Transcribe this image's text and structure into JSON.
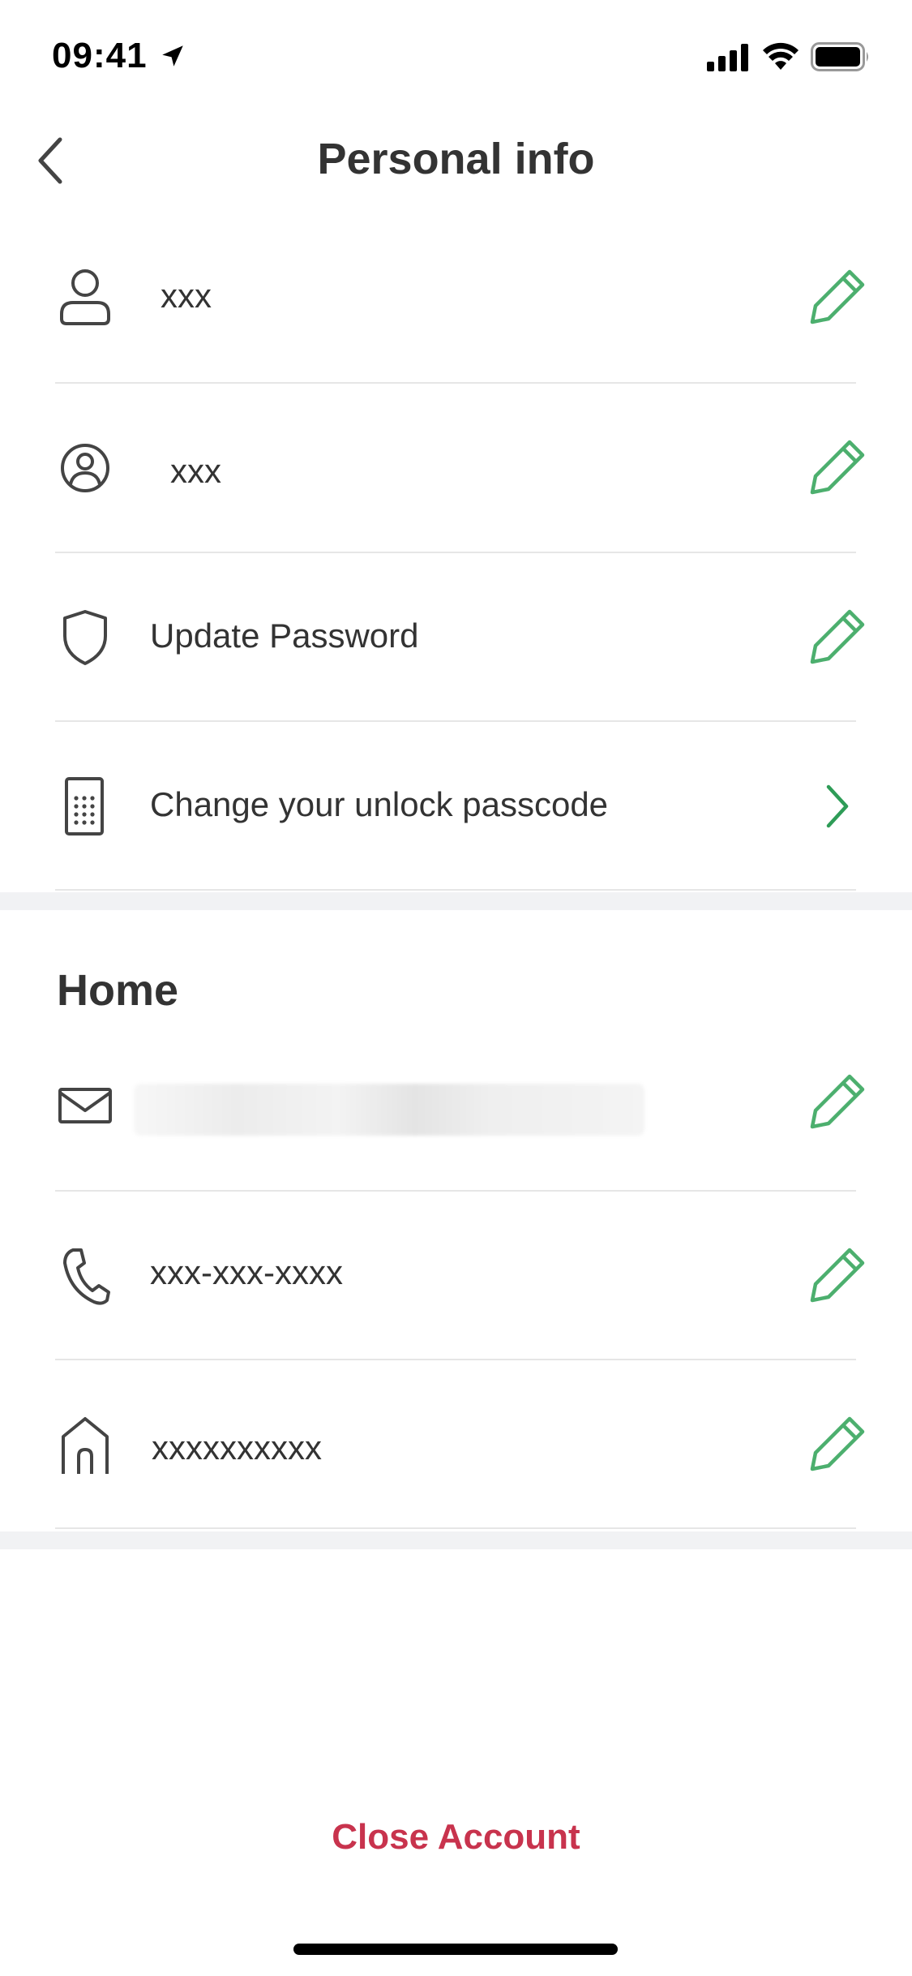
{
  "status_bar": {
    "time": "09:41"
  },
  "header": {
    "title": "Personal info"
  },
  "personal_rows": [
    {
      "icon": "person-icon",
      "label": "xxx",
      "action": "edit-pencil-icon"
    },
    {
      "icon": "user-circle-icon",
      "label": "xxx",
      "action": "edit-pencil-icon"
    },
    {
      "icon": "shield-icon",
      "label": "Update Password",
      "action": "edit-pencil-icon"
    },
    {
      "icon": "keypad-icon",
      "label": "Change your unlock passcode",
      "action": "chevron-right-icon"
    }
  ],
  "home_section": {
    "heading": "Home",
    "rows": [
      {
        "icon": "mail-icon",
        "label": "",
        "action": "edit-pencil-icon"
      },
      {
        "icon": "phone-icon",
        "label": "xxx-xxx-xxxx",
        "action": "edit-pencil-icon"
      },
      {
        "icon": "house-icon",
        "label": "xxxxxxxxxx",
        "action": "edit-pencil-icon"
      }
    ]
  },
  "footer": {
    "close_account": "Close Account"
  },
  "colors": {
    "accent_green": "#4caf6e",
    "danger_red": "#c8334d",
    "text": "#333333",
    "divider": "#e6e6e6",
    "section_gap": "#f1f2f4"
  }
}
